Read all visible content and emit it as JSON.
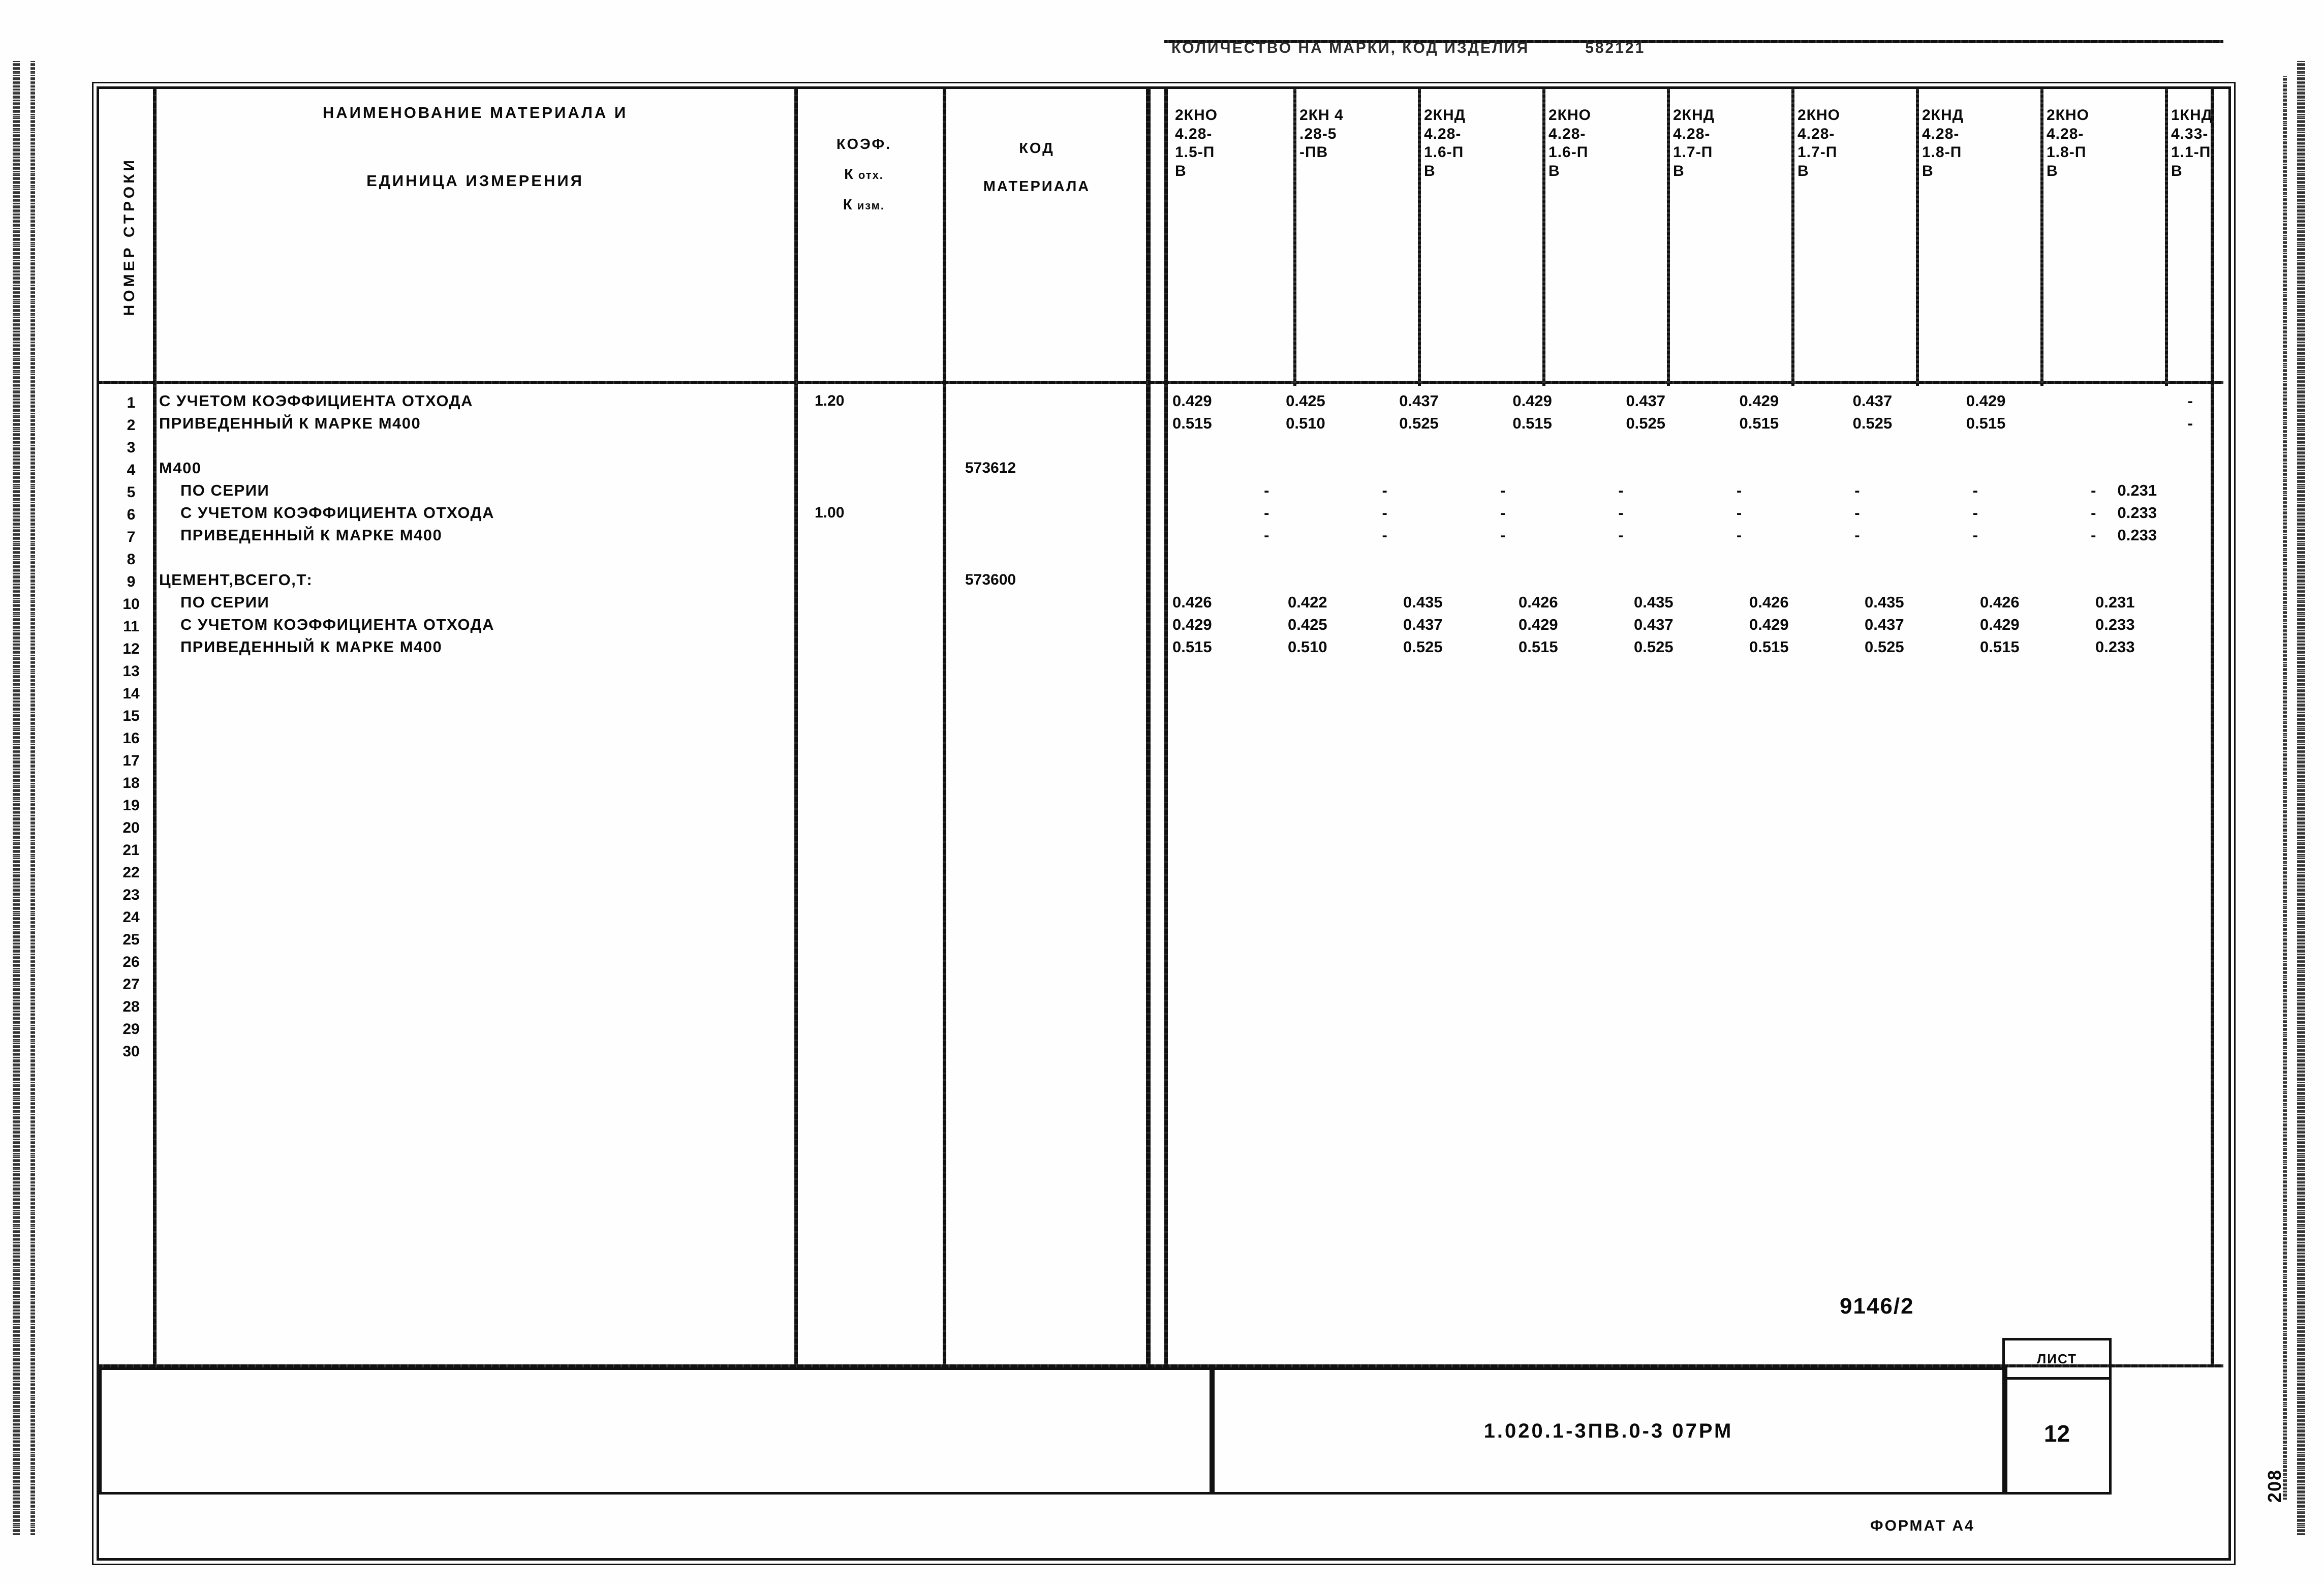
{
  "document": {
    "quantity_header": "КОЛИЧЕСТВО НА МАРКИ, КОД ИЗДЕЛИЯ",
    "product_code": "582121",
    "drawing_number": "9146/2",
    "series_code": "1.020.1-3ПВ.0-3  07РМ",
    "sheet_caption": "ЛИСТ",
    "sheet_number": "12",
    "format": "ФОРМАТ А4",
    "page_mark": "208"
  },
  "columns": {
    "rownum_header": "НОМЕР СТРОКИ",
    "name_header_line1": "НАИМЕНОВАНИЕ  МАТЕРИАЛА  И",
    "name_header_line2": "ЕДИНИЦА ИЗМЕРЕНИЯ",
    "koef_header": "КОЭФ.",
    "koef_sub1_k": "К",
    "koef_sub1_t": "отх.",
    "koef_sub2_k": "К",
    "koef_sub2_t": "изм.",
    "code_header_line1": "КОД",
    "code_header_line2": "МАТЕРИАЛА"
  },
  "marks": [
    "2КНО\n4.28-\n1.5-П\nВ",
    "2КН 4\n.28-5\n-ПВ",
    "2КНД\n4.28-\n1.6-П\nВ",
    "2КНО\n4.28-\n1.6-П\nВ",
    "2КНД\n4.28-\n1.7-П\nВ",
    "2КНО\n4.28-\n1.7-П\nВ",
    "2КНД\n4.28-\n1.8-П\nВ",
    "2КНО\n4.28-\n1.8-П\nВ",
    "1КНД\n4.33-\n1.1-П\nВ"
  ],
  "row_numbers": [
    "1",
    "2",
    "3",
    "4",
    "5",
    "6",
    "7",
    "8",
    "9",
    "10",
    "11",
    "12",
    "13",
    "14",
    "15",
    "16",
    "17",
    "18",
    "19",
    "20",
    "21",
    "22",
    "23",
    "24",
    "25",
    "26",
    "27",
    "28",
    "29",
    "30"
  ],
  "rows": [
    {
      "label": "С УЧЕТОМ КОЭФФИЦИЕНТА ОТХОДА",
      "indent": false,
      "koef": "1.20",
      "code": "",
      "values": [
        "0.429",
        "0.425",
        "0.437",
        "0.429",
        "0.437",
        "0.429",
        "0.437",
        "0.429",
        "-"
      ]
    },
    {
      "label": "ПРИВЕДЕННЫЙ К МАРКЕ М400",
      "indent": false,
      "koef": "",
      "code": "",
      "values": [
        "0.515",
        "0.510",
        "0.525",
        "0.515",
        "0.525",
        "0.515",
        "0.525",
        "0.515",
        "-"
      ]
    },
    {
      "label": "",
      "indent": false,
      "koef": "",
      "code": "",
      "values": [
        "",
        "",
        "",
        "",
        "",
        "",
        "",
        "",
        ""
      ]
    },
    {
      "label": "М400",
      "indent": false,
      "koef": "",
      "code": "573612",
      "values": [
        "",
        "",
        "",
        "",
        "",
        "",
        "",
        "",
        ""
      ]
    },
    {
      "label": "ПО СЕРИИ",
      "indent": true,
      "koef": "",
      "code": "",
      "values": [
        "-",
        "-",
        "-",
        "-",
        "-",
        "-",
        "-",
        "-",
        "0.231"
      ]
    },
    {
      "label": "С УЧЕТОМ КОЭФФИЦИЕНТА ОТХОДА",
      "indent": true,
      "koef": "1.00",
      "code": "",
      "values": [
        "-",
        "-",
        "-",
        "-",
        "-",
        "-",
        "-",
        "-",
        "0.233"
      ]
    },
    {
      "label": "ПРИВЕДЕННЫЙ К МАРКЕ М400",
      "indent": true,
      "koef": "",
      "code": "",
      "values": [
        "-",
        "-",
        "-",
        "-",
        "-",
        "-",
        "-",
        "-",
        "0.233"
      ]
    },
    {
      "label": "",
      "indent": false,
      "koef": "",
      "code": "",
      "values": [
        "",
        "",
        "",
        "",
        "",
        "",
        "",
        "",
        ""
      ]
    },
    {
      "label": "ЦЕМЕНТ,ВСЕГО,Т:",
      "indent": false,
      "koef": "",
      "code": "573600",
      "values": [
        "",
        "",
        "",
        "",
        "",
        "",
        "",
        "",
        ""
      ]
    },
    {
      "label": "ПО СЕРИИ",
      "indent": true,
      "koef": "",
      "code": "",
      "values": [
        "0.426",
        "0.422",
        "0.435",
        "0.426",
        "0.435",
        "0.426",
        "0.435",
        "0.426",
        "0.231"
      ]
    },
    {
      "label": "С УЧЕТОМ КОЭФФИЦИЕНТА ОТХОДА",
      "indent": true,
      "koef": "",
      "code": "",
      "values": [
        "0.429",
        "0.425",
        "0.437",
        "0.429",
        "0.437",
        "0.429",
        "0.437",
        "0.429",
        "0.233"
      ]
    },
    {
      "label": "ПРИВЕДЕННЫЙ К МАРКЕ М400",
      "indent": true,
      "koef": "",
      "code": "",
      "values": [
        "0.515",
        "0.510",
        "0.525",
        "0.515",
        "0.525",
        "0.515",
        "0.525",
        "0.515",
        "0.233"
      ]
    }
  ]
}
